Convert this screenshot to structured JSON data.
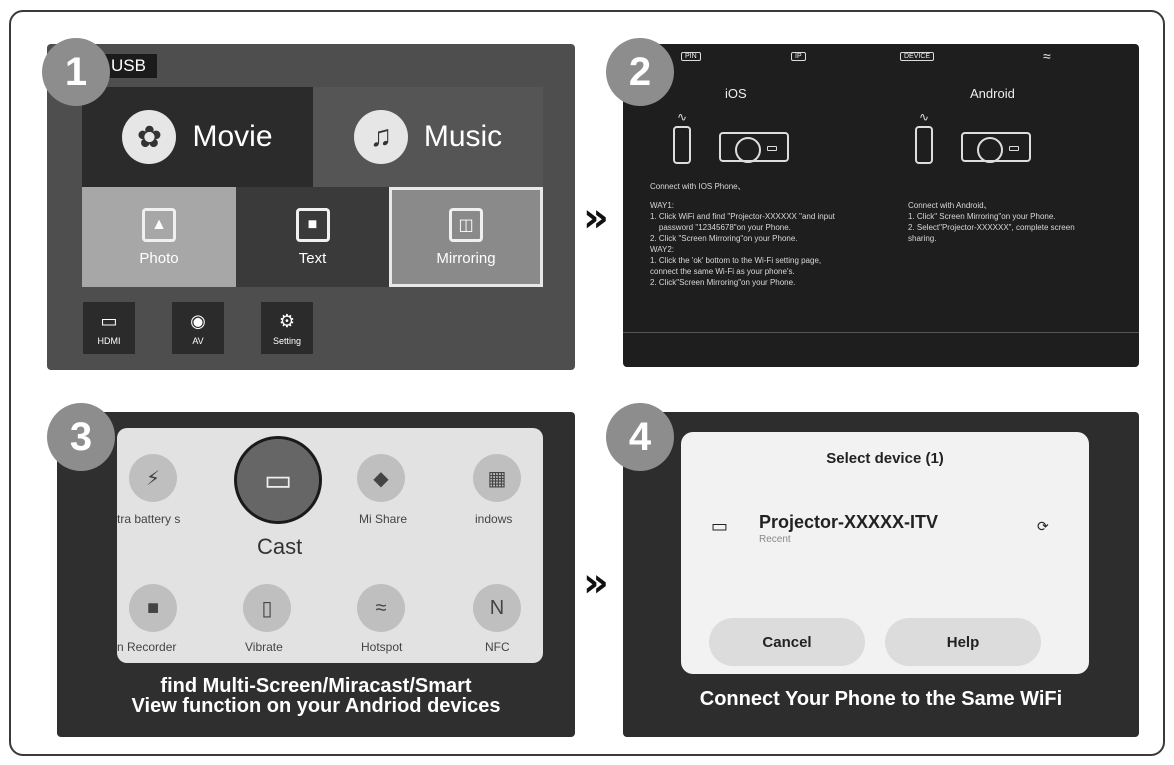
{
  "steps": [
    "1",
    "2",
    "3",
    "4"
  ],
  "arrow": "»",
  "panel1": {
    "source": "USB",
    "tiles": {
      "movie": "Movie",
      "music": "Music",
      "photo": "Photo",
      "text": "Text",
      "mirroring": "Mirroring"
    },
    "inputs": {
      "hdmi": "HDMI",
      "av": "AV",
      "setting": "Setting"
    }
  },
  "panel2": {
    "topbar": {
      "pin": "PIN",
      "ip": "IP",
      "device": "DEVICE"
    },
    "ios": {
      "title": "iOS",
      "heading": "Connect with IOS Phone、",
      "body": "WAY1:\n1. Click WiFi and find \"Projector-XXXXXX \"and input\n    password \"12345678\"on your Phone.\n2. Click \"Screen Mirroring\"on your Phone.\nWAY2:\n1. Click the 'ok' bottom to the Wi-Fi setting page,\nconnect the same Wi-Fi as your phone's.\n2. Click\"Screen Mirroring\"on your Phone."
    },
    "android": {
      "title": "Android",
      "heading": "Connect with Android、",
      "body": "1. Click\" Screen Mirroring\"on your Phone.\n2. Select\"Projector-XXXXXX\", complete screen\nsharing."
    }
  },
  "panel3": {
    "quick_settings": {
      "battery": "tra battery s",
      "cast": "Cast",
      "mi_share": "Mi Share",
      "windows": "indows",
      "recorder": "n Recorder",
      "vibrate": "Vibrate",
      "hotspot": "Hotspot",
      "nfc": "NFC"
    },
    "caption": "find Multi-Screen/Miracast/Smart\nView function on your Andriod devices"
  },
  "panel4": {
    "dialog_title": "Select device (1)",
    "device_name": "Projector-XXXXX-ITV",
    "device_sub": "Recent",
    "cancel": "Cancel",
    "help": "Help",
    "caption": "Connect Your Phone to the Same WiFi"
  }
}
